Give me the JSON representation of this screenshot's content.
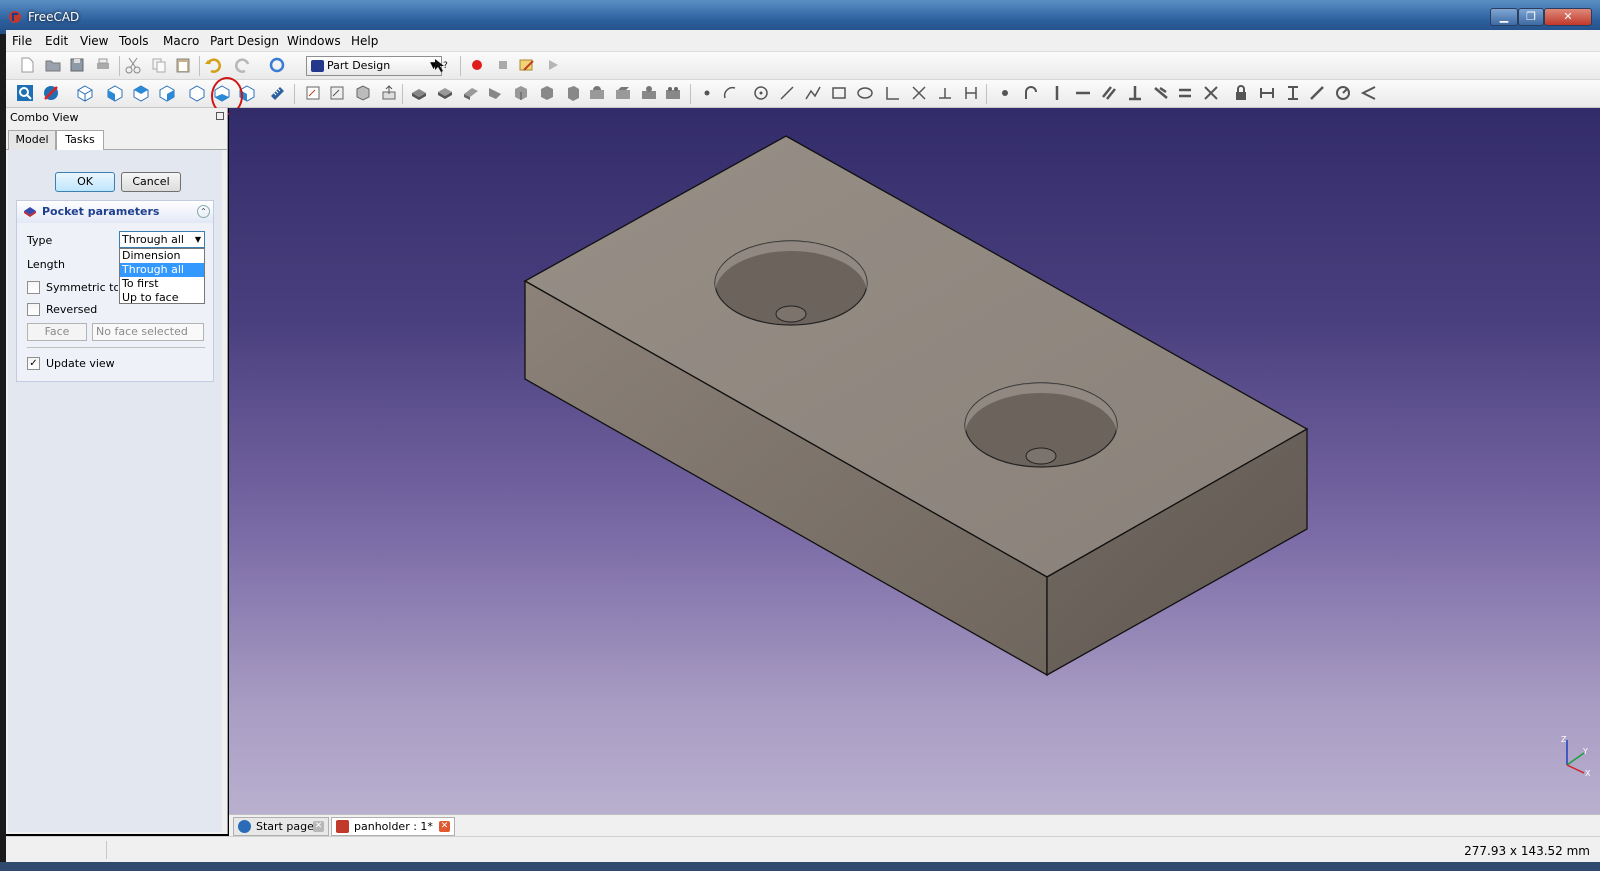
{
  "window": {
    "title": "FreeCAD",
    "min": "▁",
    "max": "❐",
    "close": "✕"
  },
  "menu": [
    "File",
    "Edit",
    "View",
    "Tools",
    "Macro",
    "Part Design",
    "Windows",
    "Help"
  ],
  "toolbar": {
    "workbench": "Part Design"
  },
  "combo": {
    "title": "Combo View",
    "tabs": {
      "model": "Model",
      "tasks": "Tasks"
    },
    "ok": "OK",
    "cancel": "Cancel",
    "pocket": {
      "title": "Pocket parameters",
      "type_label": "Type",
      "type_value": "Through all",
      "length_label": "Length",
      "options": [
        "Dimension",
        "Through all",
        "To first",
        "Up to face"
      ],
      "symmetric_label": "Symmetric to pl",
      "reversed_label": "Reversed",
      "face_button": "Face",
      "face_placeholder": "No face selected",
      "update_view_label": "Update view",
      "update_view_checked": "✓"
    }
  },
  "documents": {
    "start": "Start page",
    "panholder": "panholder : 1*"
  },
  "status": {
    "dimensions": "277.93 x 143.52 mm"
  },
  "axis": {
    "z": "Z",
    "y": "Y",
    "x": "X"
  },
  "colors": {
    "accent": "#3399ff",
    "titlebar": "#2c5f9e",
    "model": "#8f857c"
  }
}
